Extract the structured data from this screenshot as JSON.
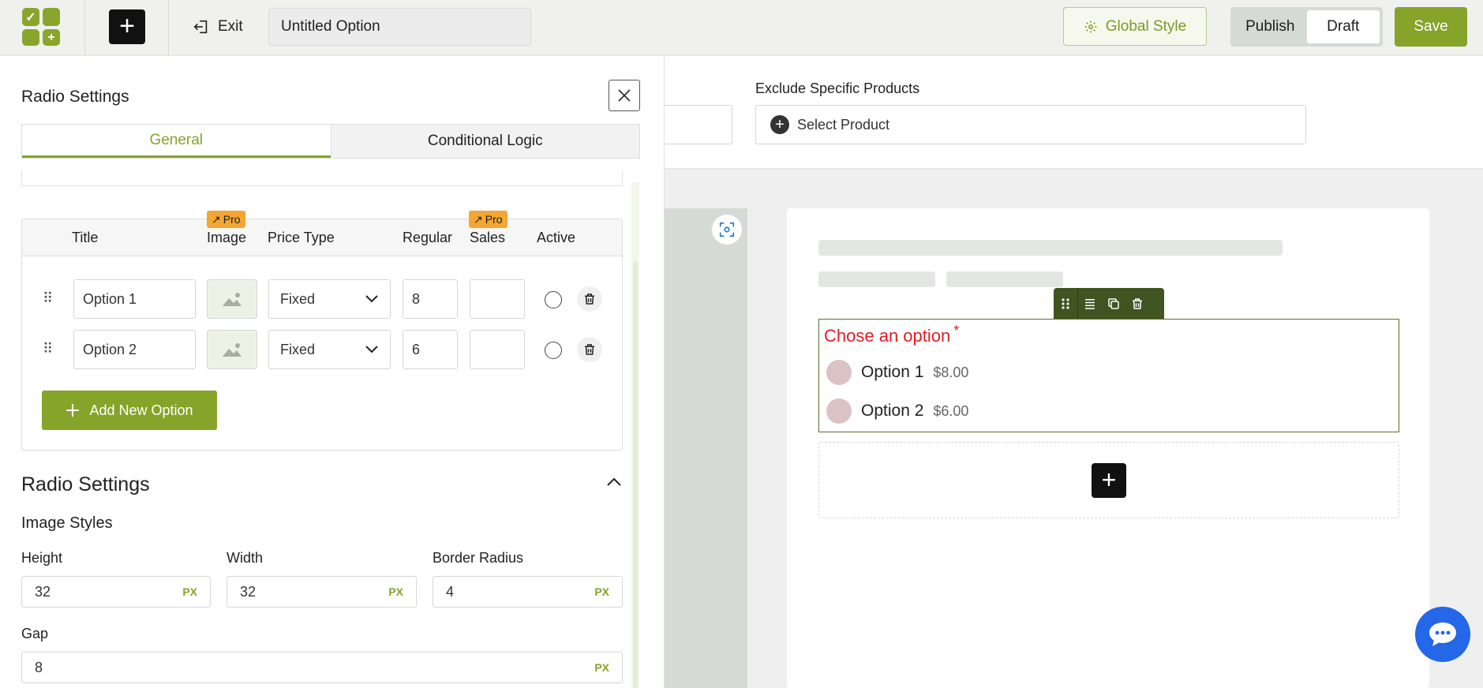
{
  "topbar": {
    "exit_label": "Exit",
    "title_value": "Untitled Option",
    "global_style_label": "Global Style",
    "publish_label": "Publish",
    "draft_label": "Draft",
    "save_label": "Save"
  },
  "panel": {
    "title": "Radio Settings",
    "tabs": [
      {
        "label": "General",
        "active": true
      },
      {
        "label": "Conditional Logic",
        "active": false
      }
    ],
    "table": {
      "headers": [
        "Title",
        "Image",
        "Price Type",
        "Regular",
        "Sales",
        "Active"
      ],
      "pro_badge": "Pro",
      "rows": [
        {
          "title": "Option 1",
          "price_type": "Fixed",
          "regular": "8",
          "sales": ""
        },
        {
          "title": "Option 2",
          "price_type": "Fixed",
          "regular": "6",
          "sales": ""
        }
      ],
      "add_option_label": "Add New Option"
    },
    "section_title": "Radio Settings",
    "image_styles_title": "Image Styles",
    "fields": {
      "height": {
        "label": "Height",
        "value": "32",
        "unit": "PX"
      },
      "width": {
        "label": "Width",
        "value": "32",
        "unit": "PX"
      },
      "border_radius": {
        "label": "Border Radius",
        "value": "4",
        "unit": "PX"
      },
      "gap": {
        "label": "Gap",
        "value": "8",
        "unit": "PX"
      }
    }
  },
  "canvas": {
    "exclude_label": "Exclude Specific Products",
    "select_product_label": "Select Product",
    "radio_label": "Chose an option",
    "required_mark": "*",
    "options": [
      {
        "name": "Option 1",
        "price": "$8.00"
      },
      {
        "name": "Option 2",
        "price": "$6.00"
      }
    ]
  },
  "colors": {
    "accent": "#86a32a",
    "required_red": "#e51b23",
    "chat_blue": "#2467e8",
    "pro_orange": "#f3a632"
  }
}
